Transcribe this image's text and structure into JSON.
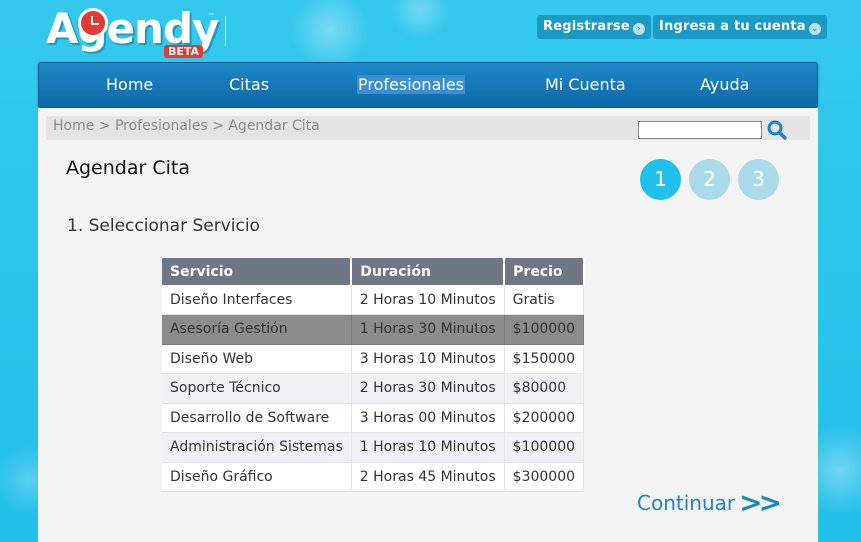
{
  "header": {
    "logo_text": "Agendy",
    "logo_badge": "BETA",
    "logo_tm": "™",
    "register_label": "Registrarse",
    "login_label": "Ingresa a tu cuenta"
  },
  "nav": {
    "items": [
      {
        "label": "Home"
      },
      {
        "label": "Citas"
      },
      {
        "label": "Profesionales"
      },
      {
        "label": "Mi Cuenta"
      },
      {
        "label": "Ayuda"
      }
    ],
    "active": "Profesionales"
  },
  "breadcrumb": {
    "text": "Home > Profesionales > Agendar Cita"
  },
  "search": {
    "value": "",
    "placeholder": ""
  },
  "page": {
    "title": "Agendar Cita",
    "section_title": "1. Seleccionar Servicio",
    "continue_label": "Continuar",
    "continue_arrow": ">>"
  },
  "steps": [
    {
      "label": "1",
      "active": true
    },
    {
      "label": "2",
      "active": false
    },
    {
      "label": "3",
      "active": false
    }
  ],
  "table": {
    "headers": [
      "Servicio",
      "Duración",
      "Precio"
    ],
    "rows": [
      {
        "servicio": "Diseño Interfaces",
        "duracion": "2 Horas 10 Minutos",
        "precio": "Gratis"
      },
      {
        "servicio": "Asesoría Gestión",
        "duracion": "1 Horas 30 Minutos",
        "precio": "$100000",
        "selected": true
      },
      {
        "servicio": "Diseño Web",
        "duracion": "3 Horas 10 Minutos",
        "precio": "$150000"
      },
      {
        "servicio": "Soporte Técnico",
        "duracion": "2 Horas 30 Minutos",
        "precio": "$80000"
      },
      {
        "servicio": "Desarrollo de Software",
        "duracion": "3 Horas 00 Minutos",
        "precio": "$200000"
      },
      {
        "servicio": "Administración Sistemas",
        "duracion": "1 Horas 10 Minutos",
        "precio": "$100000"
      },
      {
        "servicio": "Diseño Gráfico",
        "duracion": "2 Horas 45 Minutos",
        "precio": "$300000"
      }
    ]
  },
  "colors": {
    "background": "#2cc5ea",
    "nav": "#1a7dbd",
    "step_active": "#20c0ea",
    "step_inactive": "#a9dbe8",
    "table_header": "#6f7784",
    "selected_row": "#8c8c8c",
    "continue": "#1c86bd"
  }
}
